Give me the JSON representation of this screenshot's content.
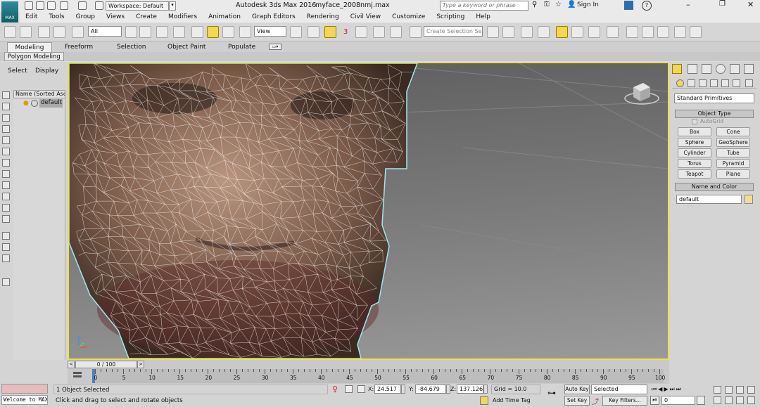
{
  "app": {
    "logo_text": "MAX",
    "title": "Autodesk 3ds Max 2016",
    "file_name": "myface_2008nmj.max",
    "workspace_label": "Workspace: Default",
    "search_placeholder": "Type a keyword or phrase",
    "sign_in": "Sign In"
  },
  "menu": [
    "Edit",
    "Tools",
    "Group",
    "Views",
    "Create",
    "Modifiers",
    "Animation",
    "Graph Editors",
    "Rendering",
    "Civil View",
    "Customize",
    "Scripting",
    "Help"
  ],
  "toolbar": {
    "selection_filter": "All",
    "ref_coord": "View",
    "snap_label": "3",
    "named_selection_placeholder": "Create Selection Set"
  },
  "ribbon": {
    "tabs": [
      "Modeling",
      "Freeform",
      "Selection",
      "Object Paint",
      "Populate"
    ],
    "sub_label": "Polygon Modeling"
  },
  "scene_explorer": {
    "menu_select": "Select",
    "menu_display": "Display",
    "column_header": "Name (Sorted Asc",
    "item": "default"
  },
  "command_panel": {
    "category": "Standard Primitives",
    "object_type_title": "Object Type",
    "autogrid": "AutoGrid",
    "buttons": [
      "Box",
      "Cone",
      "Sphere",
      "GeoSphere",
      "Cylinder",
      "Tube",
      "Torus",
      "Pyramid",
      "Teapot",
      "Plane"
    ],
    "name_color_title": "Name and Color",
    "object_name": "default",
    "object_color": "#f0e08c"
  },
  "timeline": {
    "frame_counter": "0 / 100",
    "ticks": [
      "0",
      "5",
      "10",
      "15",
      "20",
      "25",
      "30",
      "35",
      "40",
      "45",
      "50",
      "55",
      "60",
      "65",
      "70",
      "75",
      "80",
      "85",
      "90",
      "95",
      "100"
    ]
  },
  "status": {
    "maxscript_listener": "Welcome to MAX!",
    "selection_info": "1 Object Selected",
    "prompt": "Click and drag to select and rotate objects",
    "x_label": "X:",
    "x": "24.517",
    "y_label": "Y:",
    "y": "-84.679",
    "z_label": "Z:",
    "z": "137.126",
    "grid": "Grid = 10.0",
    "add_time_tag": "Add Time Tag",
    "auto_key": "Auto Key",
    "set_key": "Set Key",
    "selected_dropdown": "Selected",
    "key_filters": "Key Filters...",
    "current_frame": "0"
  },
  "colors": {
    "viewport_border": "#efe04a",
    "accent": "#f2d84e",
    "mesh": "#ffffff"
  }
}
